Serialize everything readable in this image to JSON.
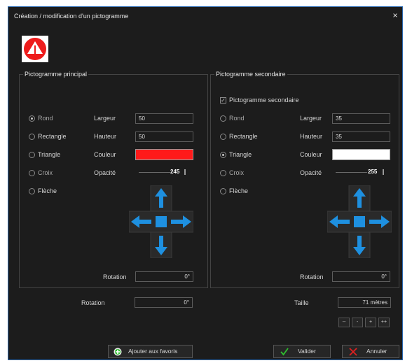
{
  "window": {
    "title": "Création / modification d'un pictogramme",
    "close_glyph": "×"
  },
  "primary": {
    "group_title": "Pictogramme principal",
    "shapes": [
      {
        "label": "Rond",
        "selected": true
      },
      {
        "label": "Rectangle",
        "selected": false
      },
      {
        "label": "Triangle",
        "selected": false
      },
      {
        "label": "Croix",
        "selected": false
      },
      {
        "label": "Flèche",
        "selected": false
      }
    ],
    "width_label": "Largeur",
    "width_value": "50",
    "height_label": "Hauteur",
    "height_value": "50",
    "color_label": "Couleur",
    "color_value": "#ff1a1a",
    "opacity_label": "Opacité",
    "opacity_value": "245",
    "rotation_label": "Rotation",
    "rotation_value": "0°"
  },
  "secondary": {
    "group_title": "Pictogramme secondaire",
    "enable_label": "Pictogramme secondaire",
    "enabled": true,
    "shapes": [
      {
        "label": "Rond",
        "selected": false
      },
      {
        "label": "Rectangle",
        "selected": false
      },
      {
        "label": "Triangle",
        "selected": true
      },
      {
        "label": "Croix",
        "selected": false
      },
      {
        "label": "Flèche",
        "selected": false
      }
    ],
    "width_label": "Largeur",
    "width_value": "35",
    "height_label": "Hauteur",
    "height_value": "35",
    "color_label": "Couleur",
    "color_value": "#ffffff",
    "opacity_label": "Opacité",
    "opacity_value": "255",
    "rotation_label": "Rotation",
    "rotation_value": "0°"
  },
  "global": {
    "rotation_label": "Rotation",
    "rotation_value": "0°",
    "size_label": "Taille",
    "size_value": "71 mètres",
    "size_buttons": [
      "--",
      "-",
      "+",
      "++"
    ]
  },
  "footer": {
    "favorites_label": "Ajouter aux favoris",
    "ok_label": "Valider",
    "cancel_label": "Annuler"
  },
  "colors": {
    "accent_blue": "#1e90e0",
    "window_border": "#2e6db5",
    "ok_green": "#2fbf2f",
    "cancel_red": "#e02020"
  },
  "icons": {
    "preview": "red-circle-with-white-triangle-icon",
    "move": "arrow-pad-icon",
    "favorites": "plus-circle-icon",
    "ok": "check-icon",
    "cancel": "x-icon"
  }
}
